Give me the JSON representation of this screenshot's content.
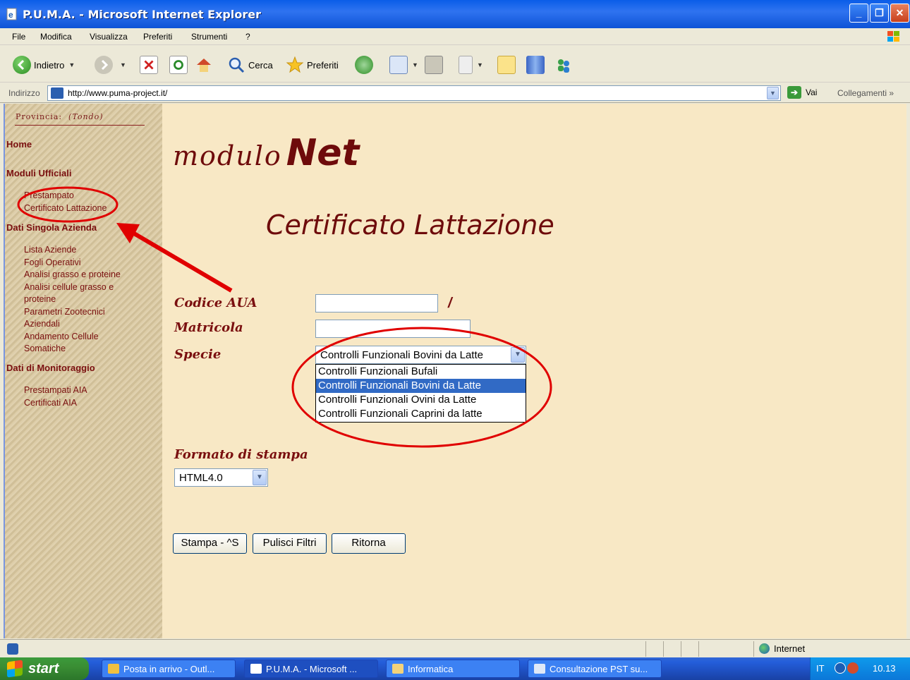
{
  "window": {
    "title": "P.U.M.A. - Microsoft Internet Explorer"
  },
  "menu": [
    "File",
    "Modifica",
    "Visualizza",
    "Preferiti",
    "Strumenti",
    "?"
  ],
  "toolbar": {
    "back": "Indietro",
    "search": "Cerca",
    "favorites": "Preferiti"
  },
  "address": {
    "label": "Indirizzo",
    "url": "http://www.puma-project.it/",
    "go": "Vai",
    "links": "Collegamenti"
  },
  "sidebar": {
    "provincia_label": "Provincia:",
    "provincia_value": "(Tondo)",
    "home": "Home",
    "section1": "Moduli Ufficiali",
    "section1_items": [
      "Prestampato",
      "Certificato Lattazione"
    ],
    "section2": "Dati Singola Azienda",
    "section2_items": [
      "Lista Aziende",
      "Fogli Operativi",
      "Analisi grasso e proteine",
      "Analisi cellule grasso e proteine",
      "Parametri Zootecnici Aziendali",
      "Andamento Cellule Somatiche"
    ],
    "section3": "Dati di Monitoraggio",
    "section3_items": [
      "Prestampati AIA",
      "Certificati AIA"
    ]
  },
  "main": {
    "logo_modulo": "modulo",
    "logo_net": "Net",
    "page_title": "Certificato Lattazione",
    "codice_label": "Codice AUA",
    "codice_value": "",
    "slash": "/",
    "matricola_label": "Matricola",
    "matricola_value": "",
    "specie_label": "Specie",
    "specie_selected": "Controlli Funzionali Bovini da Latte",
    "specie_options": [
      "Controlli Funzionali Bufali",
      "Controlli Funzionali Bovini da Latte",
      "Controlli Funzionali Ovini da Latte",
      "Controlli Funzionali Caprini da latte"
    ],
    "formato_label": "Formato di stampa",
    "formato_selected": "HTML4.0",
    "btn_stampa": "Stampa - ^S",
    "btn_pulisci": "Pulisci Filtri",
    "btn_ritorna": "Ritorna"
  },
  "status": {
    "zone": "Internet"
  },
  "taskbar": {
    "start": "start",
    "tasks": [
      "Posta in arrivo - Outl...",
      "P.U.M.A. - Microsoft ...",
      "Informatica",
      "Consultazione PST su..."
    ],
    "lang": "IT",
    "clock": "10.13"
  },
  "colors": {
    "accent_red": "#e00000",
    "brand_maroon": "#6e0b0b",
    "page_bg": "#f8e8c5",
    "selected_option": "#316ac5"
  }
}
